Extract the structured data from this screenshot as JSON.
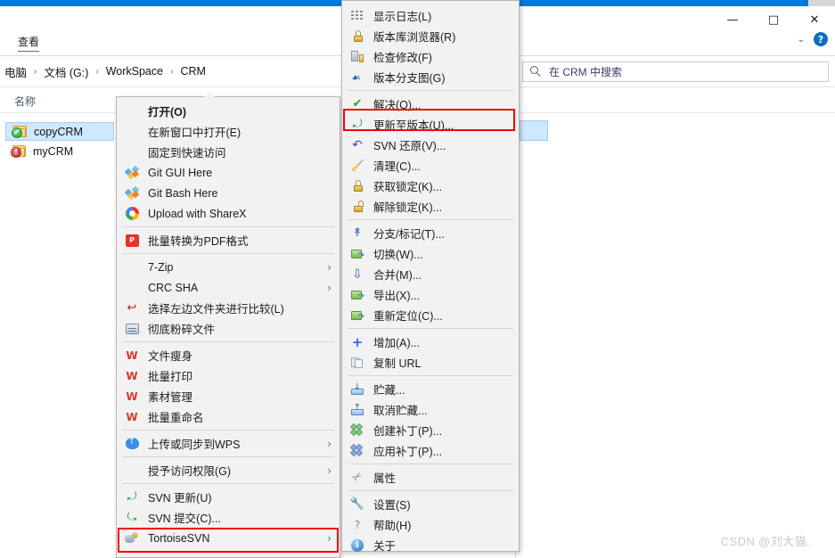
{
  "window": {
    "controls": {
      "minimize": "—",
      "maximize": "□",
      "close": "✕"
    },
    "ribbon_tab": "查看",
    "chevron": "⌄",
    "help": "?"
  },
  "breadcrumb": {
    "items": [
      "电脑",
      "文档 (G:)",
      "WorkSpace",
      "CRM"
    ],
    "separator": "›"
  },
  "search": {
    "placeholder": "在 CRM 中搜索",
    "icon": "search-icon"
  },
  "file_list": {
    "column_header": "名称",
    "items": [
      {
        "name": "copyCRM",
        "status": "modified-ok",
        "overlay": "✔",
        "selected": true
      },
      {
        "name": "myCRM",
        "status": "conflict",
        "overlay": "!",
        "selected": false
      }
    ]
  },
  "context_menu": {
    "items": [
      {
        "label": "打开(O)",
        "icon": "",
        "bold": true,
        "submenu": false
      },
      {
        "label": "在新窗口中打开(E)",
        "icon": "",
        "submenu": false
      },
      {
        "label": "固定到快速访问",
        "icon": "",
        "submenu": false
      },
      {
        "label": "Git GUI Here",
        "icon": "git-icon",
        "submenu": false
      },
      {
        "label": "Git Bash Here",
        "icon": "git-icon",
        "submenu": false
      },
      {
        "label": "Upload with ShareX",
        "icon": "sharex-icon",
        "submenu": false
      },
      {
        "separator": true
      },
      {
        "label": "批量转换为PDF格式",
        "icon": "pdf-icon",
        "submenu": false
      },
      {
        "separator": true
      },
      {
        "label": "7-Zip",
        "icon": "",
        "submenu": true
      },
      {
        "label": "CRC SHA",
        "icon": "",
        "submenu": true
      },
      {
        "label": "选择左边文件夹进行比较(L)",
        "icon": "compare-icon",
        "submenu": false
      },
      {
        "label": "彻底粉碎文件",
        "icon": "shredder-icon",
        "submenu": false
      },
      {
        "separator": true
      },
      {
        "label": "文件瘦身",
        "icon": "wps-icon",
        "submenu": false
      },
      {
        "label": "批量打印",
        "icon": "wps-icon",
        "submenu": false
      },
      {
        "label": "素材管理",
        "icon": "wps-icon",
        "submenu": false
      },
      {
        "label": "批量重命名",
        "icon": "wps-icon",
        "submenu": false
      },
      {
        "separator": true
      },
      {
        "label": "上传或同步到WPS",
        "icon": "cloud-upload-icon",
        "submenu": true
      },
      {
        "separator": true
      },
      {
        "label": "授予访问权限(G)",
        "icon": "",
        "submenu": true
      },
      {
        "separator": true
      },
      {
        "label": "SVN 更新(U)",
        "icon": "svn-update-icon",
        "submenu": false
      },
      {
        "label": "SVN 提交(C)...",
        "icon": "svn-commit-icon",
        "submenu": false
      },
      {
        "label": "TortoiseSVN",
        "icon": "tortoisesvn-icon",
        "submenu": true,
        "highlighted": true
      }
    ],
    "submenu_arrow": "›"
  },
  "tortoise_submenu": {
    "items": [
      {
        "label": "显示日志(L)",
        "icon": "show-log-icon"
      },
      {
        "label": "版本库浏览器(R)",
        "icon": "repo-browser-icon"
      },
      {
        "label": "检查修改(F)",
        "icon": "check-modifications-icon"
      },
      {
        "label": "版本分支图(G)",
        "icon": "revision-graph-icon"
      },
      {
        "separator": true
      },
      {
        "label": "解决(O)...",
        "icon": "resolve-icon"
      },
      {
        "label": "更新至版本(U)...",
        "icon": "update-to-revision-icon",
        "highlighted": true
      },
      {
        "label": "SVN 还原(V)...",
        "icon": "revert-icon"
      },
      {
        "label": "清理(C)...",
        "icon": "cleanup-icon"
      },
      {
        "label": "获取锁定(K)...",
        "icon": "get-lock-icon"
      },
      {
        "label": "解除锁定(K)...",
        "icon": "release-lock-icon"
      },
      {
        "separator": true
      },
      {
        "label": "分支/标记(T)...",
        "icon": "branch-tag-icon"
      },
      {
        "label": "切换(W)...",
        "icon": "switch-icon"
      },
      {
        "label": "合并(M)...",
        "icon": "merge-icon"
      },
      {
        "label": "导出(X)...",
        "icon": "export-icon"
      },
      {
        "label": "重新定位(C)...",
        "icon": "relocate-icon"
      },
      {
        "separator": true
      },
      {
        "label": "增加(A)...",
        "icon": "add-icon"
      },
      {
        "label": "复制 URL",
        "icon": "copy-url-icon"
      },
      {
        "separator": true
      },
      {
        "label": "贮藏...",
        "icon": "stash-icon"
      },
      {
        "label": "取消贮藏...",
        "icon": "unstash-icon"
      },
      {
        "label": "创建补丁(P)...",
        "icon": "create-patch-icon"
      },
      {
        "label": "应用补丁(P)...",
        "icon": "apply-patch-icon"
      },
      {
        "separator": true
      },
      {
        "label": "属性",
        "icon": "properties-icon"
      },
      {
        "separator": true
      },
      {
        "label": "设置(S)",
        "icon": "settings-icon"
      },
      {
        "label": "帮助(H)",
        "icon": "help-icon"
      },
      {
        "label": "关于",
        "icon": "about-icon"
      }
    ]
  },
  "annotations": {
    "highlight_color": "#f40000",
    "boxes": [
      "更新至版本(U)...",
      "TortoiseSVN"
    ]
  },
  "watermark": {
    "text": "CSDN @刘大猫."
  }
}
